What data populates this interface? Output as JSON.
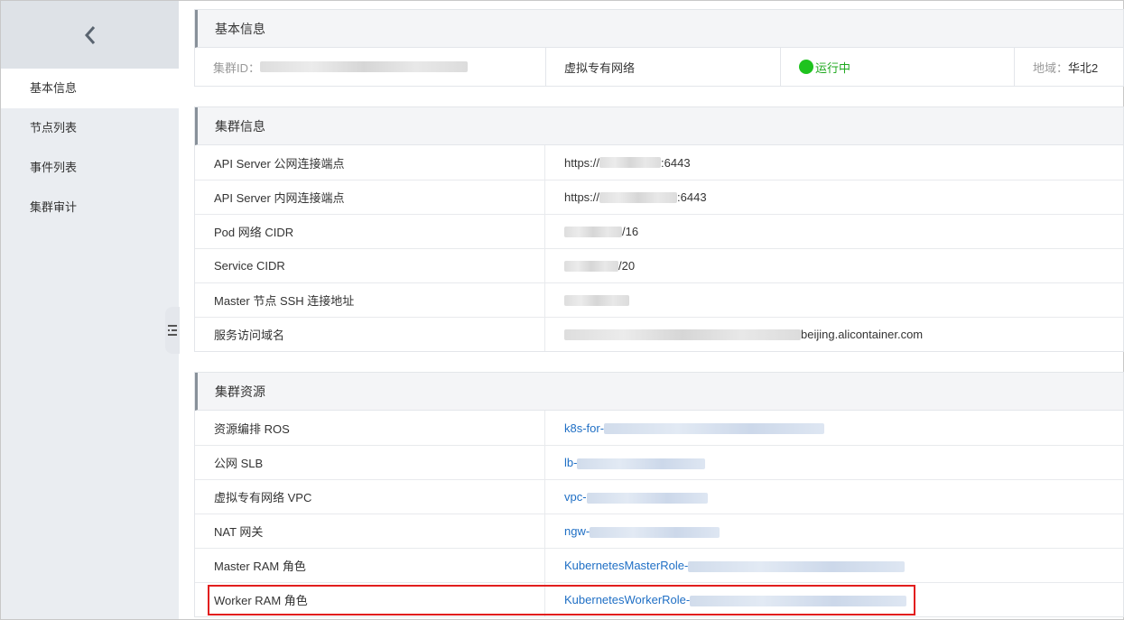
{
  "sidebar": {
    "back_icon": "chevron-left-icon",
    "items": [
      {
        "label": "基本信息",
        "active": true
      },
      {
        "label": "节点列表",
        "active": false
      },
      {
        "label": "事件列表",
        "active": false
      },
      {
        "label": "集群审计",
        "active": false
      }
    ]
  },
  "basic": {
    "title": "基本信息",
    "cluster_id_label": "集群ID：",
    "network": "虚拟专有网络",
    "status": "运行中",
    "region_label": "地域：",
    "region_value": "华北2"
  },
  "cluster_info": {
    "title": "集群信息",
    "rows": [
      {
        "key": "API Server 公网连接端点",
        "prefix": "https://",
        "suffix": ":6443"
      },
      {
        "key": "API Server 内网连接端点",
        "prefix": "https://",
        "suffix": ":6443"
      },
      {
        "key": "Pod 网络 CIDR",
        "prefix": "",
        "suffix": "/16"
      },
      {
        "key": "Service CIDR",
        "prefix": "",
        "suffix": "/20"
      },
      {
        "key": "Master 节点 SSH 连接地址",
        "prefix": "",
        "suffix": ""
      },
      {
        "key": "服务访问域名",
        "prefix": "",
        "suffix": "beijing.alicontainer.com"
      }
    ]
  },
  "resources": {
    "title": "集群资源",
    "rows": [
      {
        "key": "资源编排 ROS",
        "prefix": "k8s-for-"
      },
      {
        "key": "公网 SLB",
        "prefix": "lb-"
      },
      {
        "key": "虚拟专有网络 VPC",
        "prefix": "vpc-"
      },
      {
        "key": "NAT 网关",
        "prefix": "ngw-"
      },
      {
        "key": "Master RAM 角色",
        "prefix": "KubernetesMasterRole-"
      },
      {
        "key": "Worker RAM 角色",
        "prefix": "KubernetesWorkerRole-"
      }
    ]
  },
  "colors": {
    "accent_link": "#1f6fc5",
    "status_green": "#1ec31e",
    "highlight": "#e21e1e"
  }
}
